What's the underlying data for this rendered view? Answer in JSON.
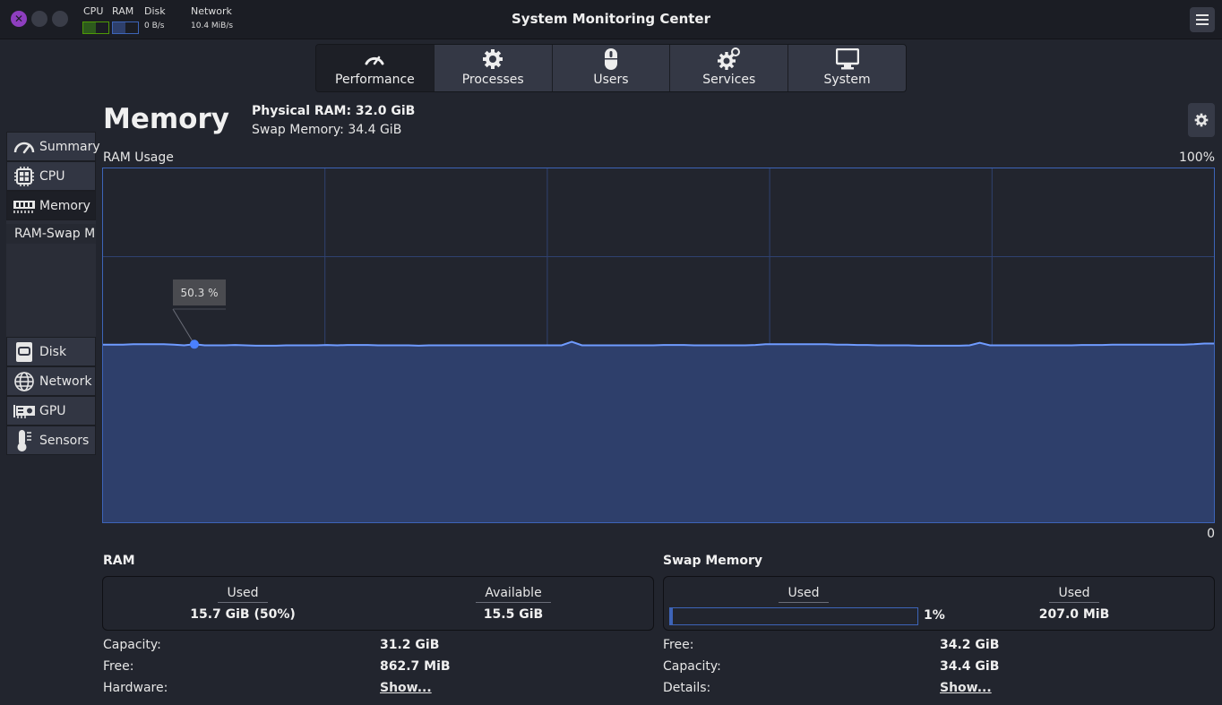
{
  "titlebar": {
    "title": "System Monitoring Center",
    "close_glyph": "✕",
    "mini": {
      "cpu_label": "CPU",
      "ram_label": "RAM",
      "disk_label": "Disk",
      "disk_value": "0 B/s",
      "network_label": "Network",
      "network_value": "10.4 MiB/s",
      "cpu_fraction": 0.5,
      "ram_fraction": 0.5,
      "cpu_color": "#4e9a06",
      "ram_color": "#3d64b8"
    }
  },
  "tabs": [
    {
      "label": "Performance",
      "icon": "speedometer-icon",
      "active": true
    },
    {
      "label": "Processes",
      "icon": "gear-icon",
      "active": false
    },
    {
      "label": "Users",
      "icon": "mouse-icon",
      "active": false
    },
    {
      "label": "Services",
      "icon": "gears-icon",
      "active": false
    },
    {
      "label": "System",
      "icon": "monitor-icon",
      "active": false
    }
  ],
  "sidebar": {
    "items": [
      {
        "label": "Summary",
        "icon": "speedometer-icon"
      },
      {
        "label": "CPU",
        "icon": "cpu-chip-icon"
      },
      {
        "label": "Memory",
        "icon": "ram-module-icon"
      },
      {
        "label": "Disk",
        "icon": "disk-icon"
      },
      {
        "label": "Network",
        "icon": "globe-icon"
      },
      {
        "label": "GPU",
        "icon": "gpu-card-icon"
      },
      {
        "label": "Sensors",
        "icon": "thermometer-icon"
      }
    ],
    "subitem": "RAM-Swap Me"
  },
  "header": {
    "title": "Memory",
    "physical_ram": "Physical RAM: 32.0 GiB",
    "swap_memory": "Swap Memory: 34.4 GiB"
  },
  "chart_data": {
    "type": "area",
    "title": "RAM Usage",
    "ylabel_max": "100%",
    "ylabel_min": "0",
    "ylim": [
      0,
      100
    ],
    "grid": true,
    "line_color": "#6f9bff",
    "fill_color": "#2e3f6b",
    "tooltip": {
      "label": "50.3 %",
      "index": 9
    },
    "values": [
      50.2,
      50.2,
      50.2,
      50.3,
      50.3,
      50.3,
      50.3,
      50.2,
      50.0,
      50.3,
      50.0,
      50.0,
      50.0,
      50.1,
      50.0,
      49.9,
      49.9,
      49.9,
      50.0,
      50.0,
      50.0,
      50.0,
      50.1,
      50.0,
      50.1,
      50.1,
      50.1,
      50.0,
      50.0,
      50.0,
      50.0,
      49.9,
      50.0,
      50.0,
      50.0,
      50.0,
      50.0,
      50.0,
      50.0,
      50.0,
      50.0,
      50.0,
      50.0,
      50.0,
      50.0,
      50.0,
      51.0,
      50.0,
      50.0,
      50.0,
      50.0,
      50.0,
      50.0,
      50.0,
      50.0,
      50.1,
      50.1,
      50.1,
      50.0,
      50.0,
      50.0,
      50.0,
      50.0,
      50.0,
      50.1,
      50.3,
      50.3,
      50.3,
      50.3,
      50.3,
      50.3,
      50.3,
      50.2,
      50.2,
      50.1,
      50.1,
      50.0,
      50.0,
      50.0,
      50.0,
      49.9,
      49.9,
      49.9,
      49.9,
      49.9,
      50.0,
      50.7,
      50.0,
      50.0,
      50.0,
      50.0,
      50.0,
      50.0,
      50.0,
      50.0,
      50.0,
      50.1,
      50.1,
      50.1,
      50.2,
      50.2,
      50.2,
      50.2,
      50.2,
      50.2,
      50.2,
      50.2,
      50.3,
      50.5,
      50.5
    ]
  },
  "ram": {
    "title": "RAM",
    "used_header": "Used",
    "used_value": "15.7 GiB (50%)",
    "available_header": "Available",
    "available_value": "15.5 GiB",
    "rows": [
      {
        "label": "Capacity:",
        "value": "31.2 GiB"
      },
      {
        "label": "Free:",
        "value": "862.7 MiB"
      },
      {
        "label": "Hardware:",
        "value": "Show..."
      }
    ]
  },
  "swap": {
    "title": "Swap Memory",
    "used_header": "Used",
    "used_percent": 1,
    "used_percent_label": "1%",
    "used_header2": "Used",
    "used_value": "207.0 MiB",
    "rows": [
      {
        "label": "Free:",
        "value": "34.2 GiB"
      },
      {
        "label": "Capacity:",
        "value": "34.4 GiB"
      },
      {
        "label": "Details:",
        "value": "Show..."
      }
    ]
  }
}
